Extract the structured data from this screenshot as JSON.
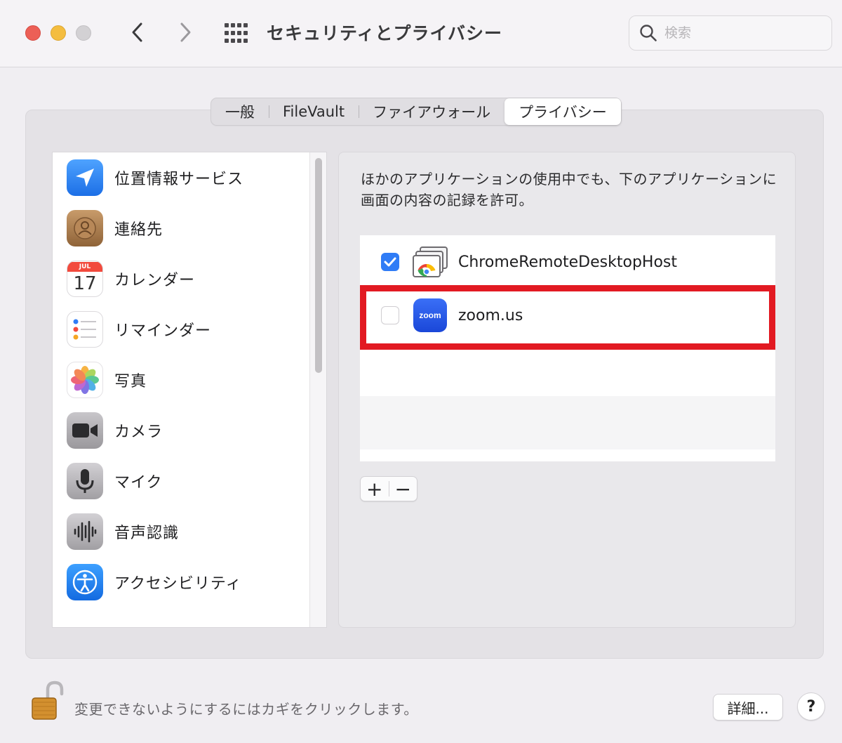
{
  "window": {
    "title": "セキュリティとプライバシー"
  },
  "search": {
    "placeholder": "検索",
    "value": ""
  },
  "tabs": [
    {
      "label": "一般",
      "selected": false
    },
    {
      "label": "FileVault",
      "selected": false
    },
    {
      "label": "ファイアウォール",
      "selected": false
    },
    {
      "label": "プライバシー",
      "selected": true
    }
  ],
  "sidebar": {
    "items": [
      {
        "label": "位置情報サービス",
        "icon": "location-arrow-icon"
      },
      {
        "label": "連絡先",
        "icon": "contacts-icon"
      },
      {
        "label": "カレンダー",
        "icon": "calendar-icon",
        "calendar_month": "JUL",
        "calendar_day": "17"
      },
      {
        "label": "リマインダー",
        "icon": "reminders-icon"
      },
      {
        "label": "写真",
        "icon": "photos-icon"
      },
      {
        "label": "カメラ",
        "icon": "camera-icon"
      },
      {
        "label": "マイク",
        "icon": "microphone-icon"
      },
      {
        "label": "音声認識",
        "icon": "speech-recognition-icon"
      },
      {
        "label": "アクセシビリティ",
        "icon": "accessibility-icon"
      }
    ]
  },
  "content": {
    "description": "ほかのアプリケーションの使用中でも、下のアプリケーションに画面の内容の記録を許可。",
    "apps": [
      {
        "name": "ChromeRemoteDesktopHost",
        "checked": true,
        "icon": "chrome-remote-desktop-icon"
      },
      {
        "name": "zoom.us",
        "checked": false,
        "icon": "zoom-icon",
        "icon_text": "zoom"
      }
    ],
    "add_label": "+",
    "remove_label": "−"
  },
  "footer": {
    "lock_text": "変更できないようにするにはカギをクリックします。",
    "advanced_label": "詳細...",
    "help_label": "?"
  },
  "colors": {
    "highlight": "#e21a22",
    "accent": "#2f7cf6"
  }
}
